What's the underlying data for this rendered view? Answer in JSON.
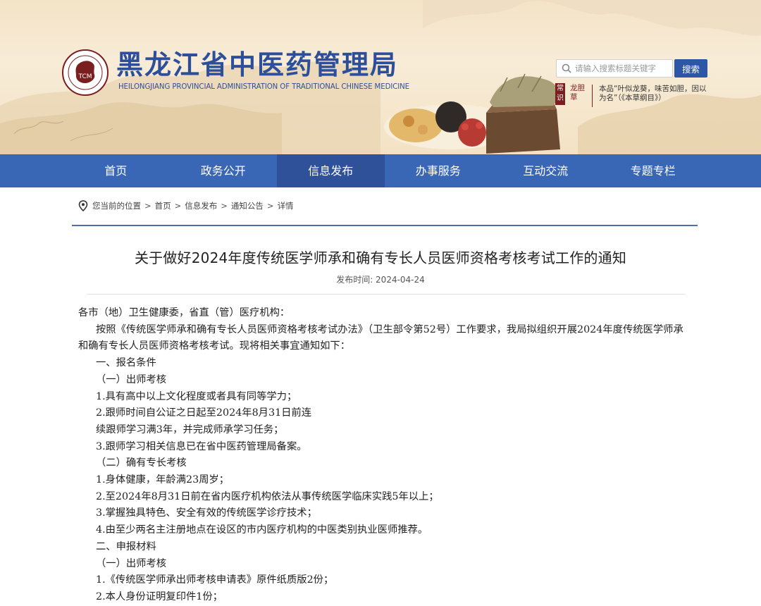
{
  "header": {
    "logo_cn": "黑龙江省中医药管理局",
    "logo_en": "HEILONGJIANG PROVINCIAL ADMINISTRATION OF TRADITIONAL CHINESE MEDICINE",
    "emblem_text": "TCM",
    "search": {
      "placeholder": "请输入搜索标题关键字",
      "button_label": "搜索"
    },
    "tip": {
      "badge": "常识",
      "herb": "龙胆草",
      "text": "本品“叶似龙葵，味苦如胆，因以为名”（《本草纲目》）"
    }
  },
  "nav": {
    "items": [
      {
        "label": "首页"
      },
      {
        "label": "政务公开"
      },
      {
        "label": "信息发布"
      },
      {
        "label": "办事服务"
      },
      {
        "label": "互动交流"
      },
      {
        "label": "专题专栏"
      }
    ],
    "active_index": 2
  },
  "breadcrumb": {
    "prefix": "您当前的位置",
    "items": [
      "首页",
      "信息发布",
      "通知公告",
      "详情"
    ],
    "separator": ">"
  },
  "article": {
    "title": "关于做好2024年度传统医学师承和确有专长人员医师资格考核考试工作的通知",
    "date_label": "发布时间: 2024-04-24",
    "paragraphs": [
      "各市（地）卫生健康委，省直（管）医疗机构：",
      "按照《传统医学师承和确有专长人员医师资格考核考试办法》（卫生部令第52号）工作要求，我局拟组织开展2024年度传统医学师承和确有专长人员医师资格考核考试。现将相关事宜通知如下：",
      "一、报名条件",
      "（一）出师考核",
      "1.具有高中以上文化程度或者具有同等学力；",
      "2.跟师时间自公证之日起至2024年8月31日前连",
      "续跟师学习满3年，并完成师承学习任务；",
      "3.跟师学习相关信息已在省中医药管理局备案。",
      "（二）确有专长考核",
      "1.身体健康，年龄满23周岁；",
      "2.至2024年8月31日前在省内医疗机构依法从事传统医学临床实践5年以上；",
      "3.掌握独具特色、安全有效的传统医学诊疗技术；",
      "4.由至少两名主注册地点在设区的市内医疗机构的中医类别执业医师推荐。",
      "二、申报材料",
      "（一）出师考核",
      "1.《传统医学师承出师考核申请表》原件纸质版2份；",
      "2.本人身份证明复印件1份；"
    ]
  },
  "colors": {
    "brand_blue": "#2d4f9a",
    "nav_bg": "#3a67b5",
    "nav_active": "#2f519a",
    "tip_red": "#7a1f1f"
  }
}
